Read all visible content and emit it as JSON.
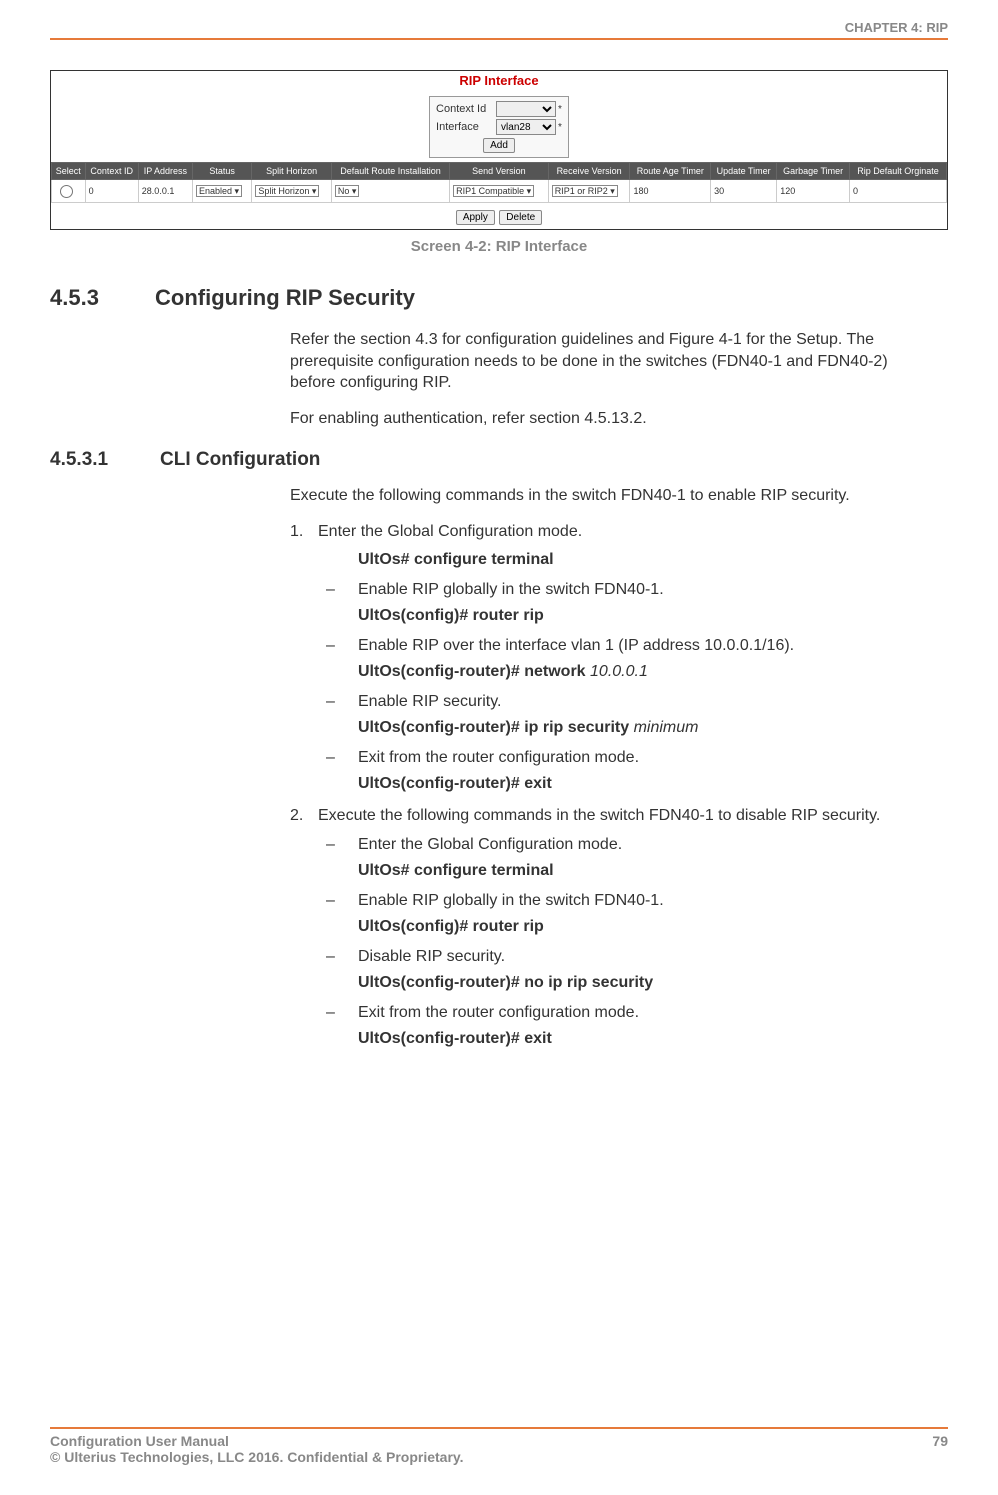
{
  "header": {
    "chapter": "CHAPTER 4: RIP"
  },
  "figure": {
    "title": "RIP Interface",
    "form": {
      "context_label": "Context Id",
      "interface_label": "Interface",
      "interface_value": "vlan28",
      "add_btn": "Add"
    },
    "columns": {
      "select": "Select",
      "context_id": "Context ID",
      "ip_address": "IP Address",
      "status": "Status",
      "split_horizon": "Split Horizon",
      "default_route": "Default Route Installation",
      "send_version": "Send Version",
      "receive_version": "Receive Version",
      "route_age": "Route Age Timer",
      "update_timer": "Update Timer",
      "garbage_timer": "Garbage Timer",
      "rip_default": "Rip Default Orginate"
    },
    "row": {
      "context_id": "0",
      "ip_address": "28.0.0.1",
      "status": "Enabled",
      "split_horizon": "Split Horizon",
      "default_route": "No",
      "send_version": "RIP1 Compatible",
      "receive_version": "RIP1 or RIP2",
      "route_age": "180",
      "update_timer": "30",
      "garbage_timer": "120",
      "rip_default": "0"
    },
    "actions": {
      "apply": "Apply",
      "delete": "Delete"
    },
    "caption": "Screen 4-2: RIP Interface"
  },
  "section": {
    "num": "4.5.3",
    "title": "Configuring RIP Security",
    "p1": "Refer the section 4.3 for configuration guidelines and Figure 4-1 for the Setup. The prerequisite configuration needs to be done in the switches (FDN40-1 and FDN40-2) before configuring RIP.",
    "p2": "For enabling authentication, refer section 4.5.13.2."
  },
  "subsection": {
    "num": "4.5.3.1",
    "title": "CLI Configuration",
    "intro": "Execute the following commands in the switch FDN40-1 to enable RIP security.",
    "step1": {
      "num": "1.",
      "text": "Enter the Global Configuration mode.",
      "cmd1": "UltOs# configure terminal",
      "d1": "Enable RIP globally in the switch FDN40-1.",
      "cmd2": "UltOs(config)# router rip",
      "d2": "Enable RIP over the interface vlan 1 (IP address 10.0.0.1/16).",
      "cmd3_a": "UltOs(config-router)# network ",
      "cmd3_b": "10.0.0.1",
      "d3": "Enable RIP security.",
      "cmd4_a": "UltOs(config-router)# ip rip security ",
      "cmd4_b": "minimum",
      "d4": "Exit from the router configuration mode.",
      "cmd5": "UltOs(config-router)# exit"
    },
    "step2": {
      "num": "2.",
      "text": "Execute the following commands in the switch FDN40-1 to disable RIP security.",
      "d1": "Enter the Global Configuration mode.",
      "cmd1": "UltOs# configure terminal",
      "d2": "Enable RIP globally in the switch FDN40-1.",
      "cmd2": "UltOs(config)# router rip",
      "d3": "Disable RIP security.",
      "cmd3": "UltOs(config-router)# no ip rip security",
      "d4": "Exit from the router configuration mode.",
      "cmd4": "UltOs(config-router)# exit"
    }
  },
  "footer": {
    "left1": "Configuration User Manual",
    "left2": "© Ulterius Technologies, LLC 2016. Confidential & Proprietary.",
    "page": "79"
  }
}
